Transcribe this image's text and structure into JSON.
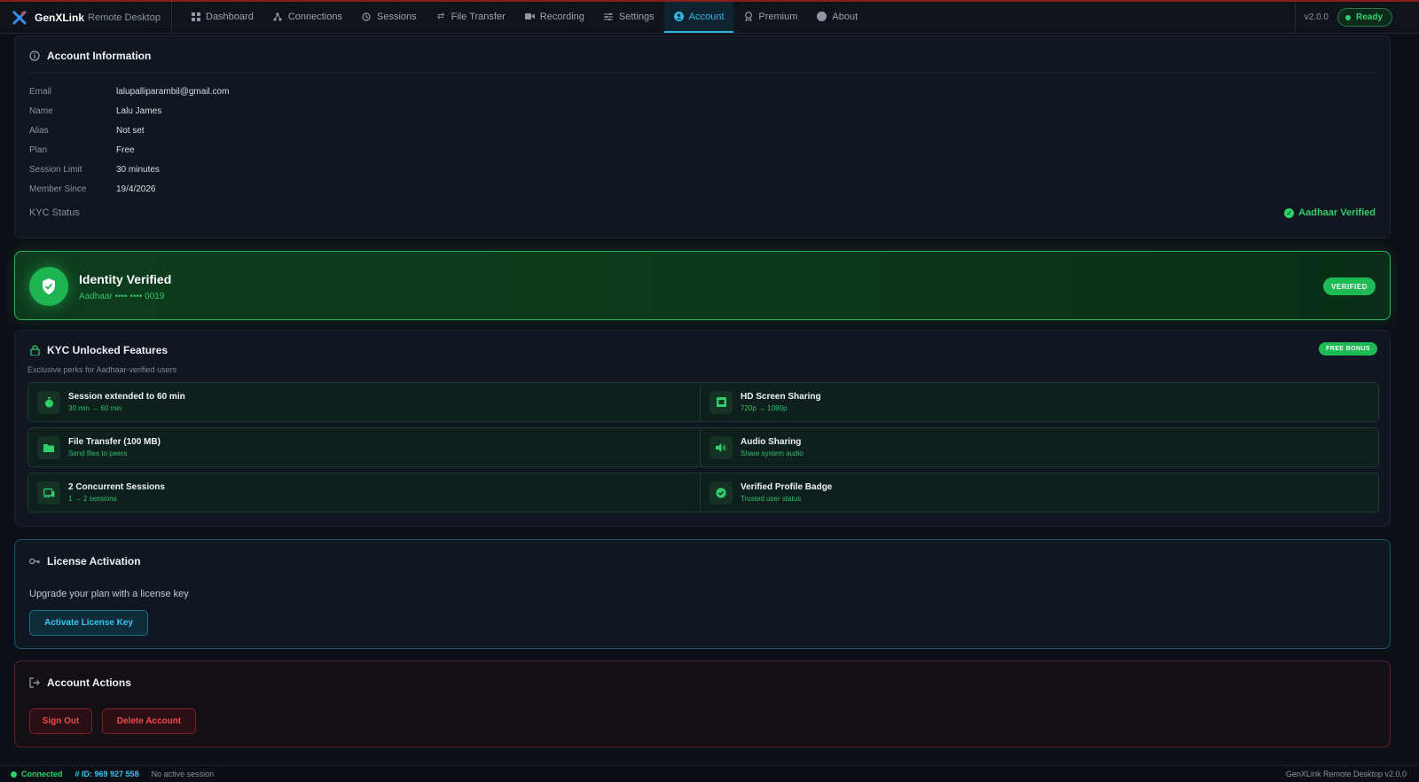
{
  "app": {
    "name": "GenXLink",
    "subtitle": "Remote Desktop",
    "version": "v2.0.0",
    "status": "Ready"
  },
  "nav": {
    "items": [
      {
        "label": "Dashboard",
        "icon": "dashboard-icon"
      },
      {
        "label": "Connections",
        "icon": "connections-icon"
      },
      {
        "label": "Sessions",
        "icon": "history-icon"
      },
      {
        "label": "File Transfer",
        "icon": "transfer-icon"
      },
      {
        "label": "Recording",
        "icon": "camera-icon"
      },
      {
        "label": "Settings",
        "icon": "sliders-icon"
      },
      {
        "label": "Account",
        "icon": "user-circle-icon",
        "active": true
      },
      {
        "label": "Premium",
        "icon": "award-icon"
      },
      {
        "label": "About",
        "icon": "info-circle-icon"
      }
    ]
  },
  "account_info": {
    "title": "Account Information",
    "rows": [
      {
        "key": "Email",
        "value": "lalupalliparambil@gmail.com"
      },
      {
        "key": "Name",
        "value": "Lalu James"
      },
      {
        "key": "Alias",
        "value": "Not set"
      },
      {
        "key": "Plan",
        "value": "Free"
      },
      {
        "key": "Session Limit",
        "value": "30 minutes"
      },
      {
        "key": "Member Since",
        "value": "19/4/2026"
      }
    ],
    "kyc_label": "KYC Status",
    "kyc_value": "Aadhaar Verified"
  },
  "identity": {
    "title": "Identity Verified",
    "subtitle": "Aadhaar •••• •••• 0019",
    "badge": "VERIFIED"
  },
  "kyc_features": {
    "title": "KYC Unlocked Features",
    "subtitle": "Exclusive perks for Aadhaar-verified users",
    "badge": "FREE BONUS",
    "items": [
      {
        "title": "Session extended to 60 min",
        "detail": "30 min → 60 min",
        "icon": "timer-icon"
      },
      {
        "title": "HD Screen Sharing",
        "detail": "720p → 1080p",
        "icon": "screen-icon"
      },
      {
        "title": "File Transfer (100 MB)",
        "detail": "Send files to peers",
        "icon": "folder-icon"
      },
      {
        "title": "Audio Sharing",
        "detail": "Share system audio",
        "icon": "speaker-icon"
      },
      {
        "title": "2 Concurrent Sessions",
        "detail": "1 → 2 sessions",
        "icon": "devices-icon"
      },
      {
        "title": "Verified Profile Badge",
        "detail": "Trusted user status",
        "icon": "badge-check-icon"
      }
    ]
  },
  "license": {
    "title": "License Activation",
    "text": "Upgrade your plan with a license key",
    "button": "Activate License Key"
  },
  "account_actions": {
    "title": "Account Actions",
    "sign_out": "Sign Out",
    "delete": "Delete Account"
  },
  "statusbar": {
    "connection": "Connected",
    "id": "# ID: 969 927 558",
    "session": "No active session",
    "right": "GenXLink Remote Desktop v2.0.0"
  },
  "colors": {
    "accent": "#2bb3e0",
    "success": "#2fd06b",
    "danger": "#f04b4b",
    "background": "#0d1117"
  }
}
